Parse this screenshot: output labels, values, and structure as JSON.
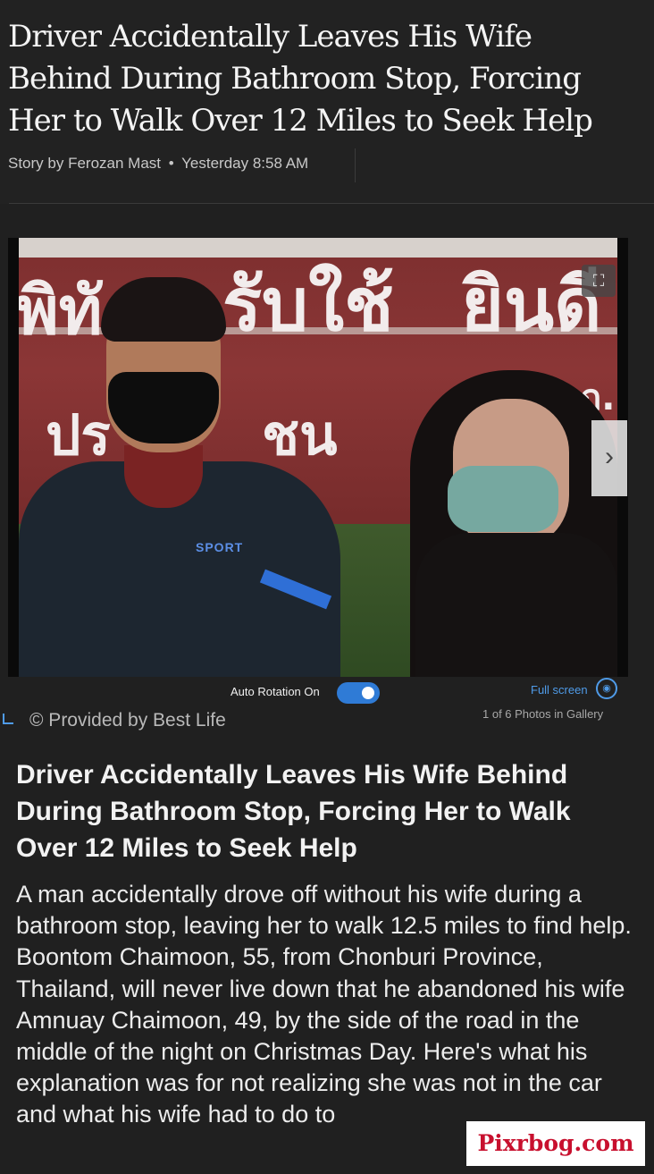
{
  "article": {
    "headline": "Driver Accidentally Leaves His Wife Behind During Bathroom Stop, Forcing Her to Walk Over 12 Miles to Seek Help",
    "byline_author": "Story by Ferozan Mast",
    "byline_separator": "•",
    "byline_time": "Yesterday 8:58 AM"
  },
  "gallery": {
    "sign_text_line1a": "พิทั",
    "sign_text_line1b": "รับใช้",
    "sign_text_line1c": "ยินดี",
    "sign_text_line2a": "ปร",
    "sign_text_line2b": "ชน",
    "sign_text_small": "ก.",
    "shirt_text": "SPORT",
    "expand_glyph": "⛶",
    "next_glyph": "›",
    "auto_rotation_label": "Auto Rotation On",
    "auto_rotation_on": true,
    "fullscreen_label": "Full screen",
    "fullscreen_glyph": "◉",
    "provided_by": "© Provided by Best Life",
    "photo_count": "1 of 6 Photos in Gallery",
    "icons": [
      "expand-icon",
      "chevron-right-icon",
      "fullscreen-icon"
    ]
  },
  "caption": {
    "title": "Driver Accidentally Leaves His Wife Behind During Bathroom Stop, Forcing Her to Walk Over 12 Miles to Seek Help",
    "body": "A man accidentally drove off without his wife during a bathroom stop, leaving her to walk 12.5 miles to find help. Boontom Chaimoon, 55, from Chonburi Province, Thailand, will never live down that he abandoned his wife Amnuay Chaimoon, 49, by the side of the road in the middle of the night on Christmas Day. Here's what his explanation was for not realizing she was not in the car and what his wife had to do to"
  },
  "watermark": {
    "text": "Pixrbog.com"
  },
  "colors": {
    "background": "#202020",
    "accent_blue": "#4f9be8",
    "toggle_blue": "#2f7bd6",
    "watermark_red": "#c8102e"
  }
}
